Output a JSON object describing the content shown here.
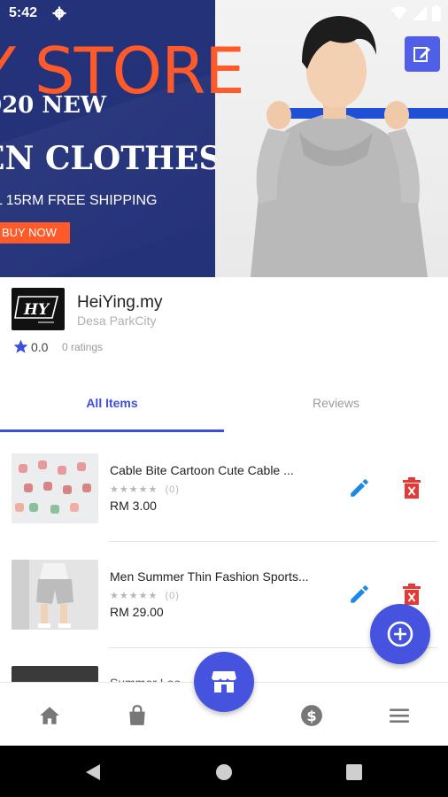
{
  "status_bar": {
    "time": "5:42"
  },
  "banner": {
    "store_title": "Y STORE",
    "promo_year": "020 NEW",
    "promo_line": "EN CLOTHES",
    "promo_shipping": "L 15RM FREE SHIPPING",
    "buy_now": "BUY NOW"
  },
  "store": {
    "name": "HeiYing.my",
    "location": "Desa ParkCity",
    "logo_text": "HY",
    "rating": "0.0",
    "rating_count": "0 ratings"
  },
  "tabs": [
    {
      "label": "All Items",
      "active": true
    },
    {
      "label": "Reviews",
      "active": false
    }
  ],
  "items": [
    {
      "title": "Cable Bite Cartoon Cute Cable ...",
      "stars": "★★★★★",
      "reviews": "(0)",
      "price": "RM 3.00"
    },
    {
      "title": "Men Summer Thin Fashion Sports...",
      "stars": "★★★★★",
      "reviews": "(0)",
      "price": "RM 29.00"
    },
    {
      "title": "Summer Loo... Shirt Men...",
      "stars": "",
      "reviews": "",
      "price": ""
    }
  ],
  "colors": {
    "accent": "#4553df",
    "banner_blue": "#24327a",
    "banner_orange": "#ff5a2a",
    "delete_red": "#e53935",
    "edit_blue": "#1e88e5"
  },
  "bottom_nav": [
    "home-icon",
    "shopping-bag-icon",
    "store-icon",
    "dollar-icon",
    "menu-icon"
  ]
}
